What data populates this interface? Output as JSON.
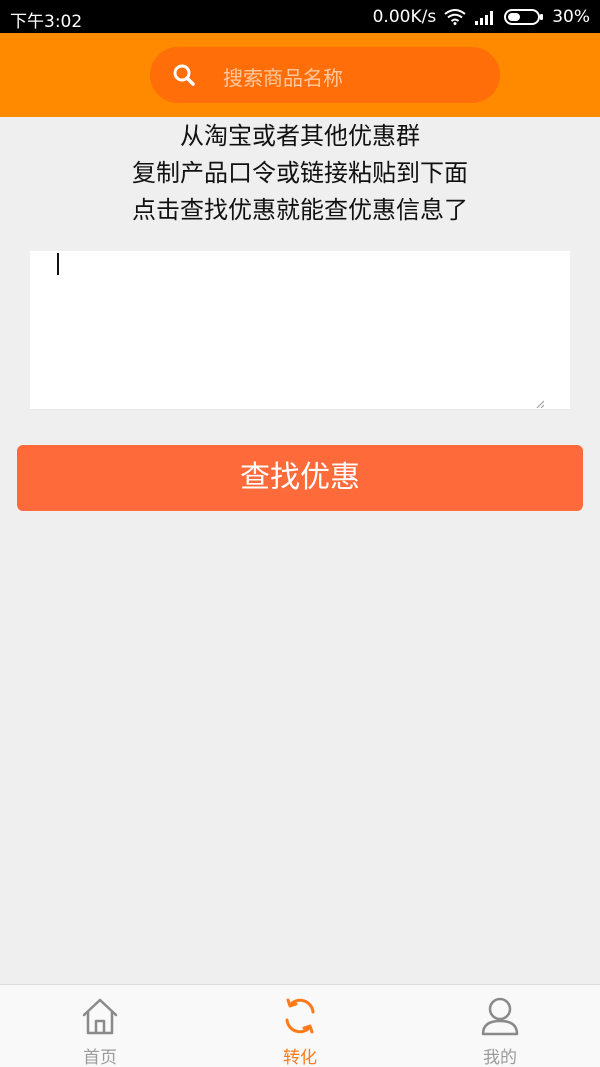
{
  "status_bar": {
    "time": "下午3:02",
    "network_speed": "0.00K/s",
    "battery": "30%",
    "icons": [
      "wifi-icon",
      "signal-icon",
      "battery-icon"
    ]
  },
  "search": {
    "placeholder": "搜索商品名称",
    "icon": "search-icon"
  },
  "instructions": {
    "line1": "从淘宝或者其他优惠群",
    "line2": "复制产品口令或链接粘贴到下面",
    "line3": "点击查找优惠就能查优惠信息了"
  },
  "paste_area": {
    "value": ""
  },
  "action": {
    "button_label": "查找优惠"
  },
  "tabs": [
    {
      "label": "首页",
      "icon": "home-icon",
      "active": false
    },
    {
      "label": "转化",
      "icon": "convert-icon",
      "active": true
    },
    {
      "label": "我的",
      "icon": "user-icon",
      "active": false
    }
  ],
  "colors": {
    "header": "#ff8a00",
    "search_box": "#ff6e09",
    "button": "#ff6a3a",
    "active_tab": "#ff7a1a",
    "inactive_tab": "#9b9b9b",
    "background": "#efefef"
  }
}
